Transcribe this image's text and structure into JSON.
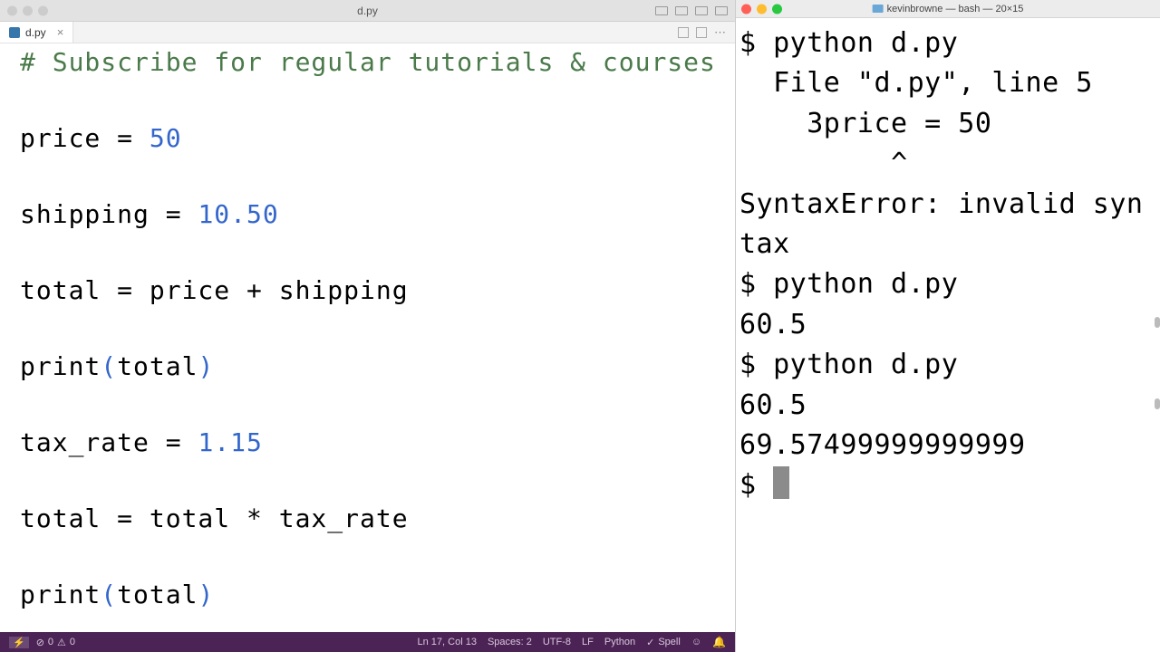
{
  "editor": {
    "title": "d.py",
    "tab": {
      "label": "d.py"
    },
    "code": {
      "l0_comment": "# Subscribe for regular tutorials & courses",
      "l2_pre": "price = ",
      "l2_num": "50",
      "l4_pre": "shipping = ",
      "l4_num": "10.50",
      "l6": "total = price + shipping",
      "l8_a": "print",
      "l8_p1": "(",
      "l8_b": "total",
      "l8_p2": ")",
      "l10_pre": "tax_rate = ",
      "l10_num": "1.15",
      "l12": "total = total * tax_rate",
      "l14_a": "print",
      "l14_p1": "(",
      "l14_b": "total",
      "l14_p2": ")"
    },
    "status": {
      "errors": "0",
      "warnings": "0",
      "position": "Ln 17, Col 13",
      "spaces": "Spaces: 2",
      "encoding": "UTF-8",
      "eol": "LF",
      "language": "Python",
      "spell": "Spell"
    }
  },
  "terminal": {
    "title": "kevinbrowne — bash — 20×15",
    "prompt": "$",
    "lines": {
      "l1": "$ python d.py",
      "l2": "  File \"d.py\", line 5",
      "l3": "    3price = 50",
      "l4": "         ^",
      "l5": "SyntaxError: invalid syntax",
      "l6": "$ python d.py",
      "l7": "60.5",
      "l8": "$ python d.py",
      "l9": "60.5",
      "l10": "69.57499999999999",
      "l11_prompt": "$ "
    }
  }
}
